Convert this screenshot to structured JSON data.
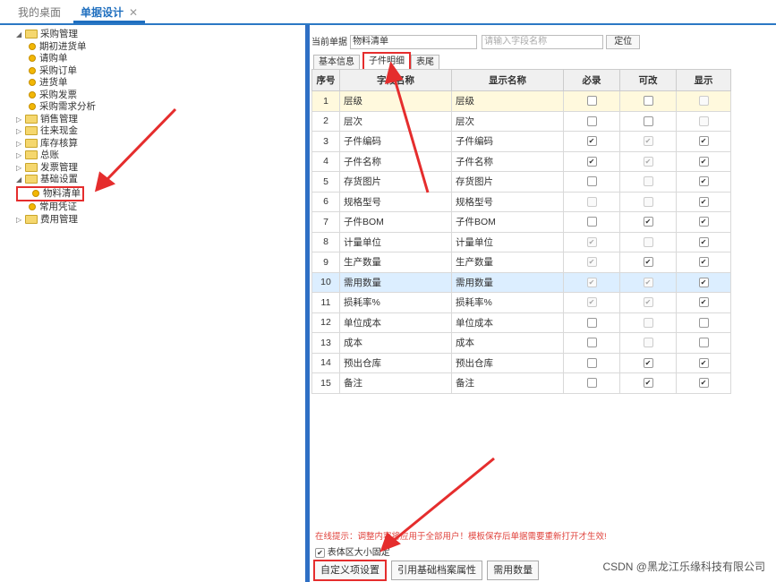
{
  "tabs": [
    {
      "label": "我的桌面"
    },
    {
      "label": "单据设计"
    }
  ],
  "tab_close": "✕",
  "tree": [
    {
      "label": "采购管理",
      "type": "folder",
      "expanded": true,
      "children": [
        "期初进货单",
        "请购单",
        "采购订单",
        "进货单",
        "采购发票",
        "采购需求分析"
      ]
    },
    {
      "label": "销售管理",
      "type": "folder",
      "expanded": false
    },
    {
      "label": "往来现金",
      "type": "folder",
      "expanded": false
    },
    {
      "label": "库存核算",
      "type": "folder",
      "expanded": false
    },
    {
      "label": "总账",
      "type": "folder",
      "expanded": false
    },
    {
      "label": "发票管理",
      "type": "folder",
      "expanded": false
    },
    {
      "label": "基础设置",
      "type": "folder",
      "expanded": true,
      "children": [
        "物料清单",
        "常用凭证"
      ]
    },
    {
      "label": "费用管理",
      "type": "folder",
      "expanded": false
    }
  ],
  "current_doc": {
    "label": "当前单据",
    "value": "物料清单"
  },
  "search": {
    "placeholder": "请输入字段名称"
  },
  "locate_button": "定位",
  "subtabs": [
    "基本信息",
    "子件明细",
    "表尾"
  ],
  "columns": [
    "序号",
    "字段名称",
    "显示名称",
    "必录",
    "可改",
    "显示"
  ],
  "rows": [
    {
      "no": "1",
      "field": "层级",
      "display": "层级",
      "req": [
        false,
        false
      ],
      "edit": [
        false,
        false
      ],
      "show": [
        false,
        true
      ]
    },
    {
      "no": "2",
      "field": "层次",
      "display": "层次",
      "req": [
        false,
        false
      ],
      "edit": [
        false,
        false
      ],
      "show": [
        false,
        true
      ]
    },
    {
      "no": "3",
      "field": "子件编码",
      "display": "子件编码",
      "req": [
        true,
        false
      ],
      "edit": [
        true,
        true
      ],
      "show": [
        true,
        false
      ]
    },
    {
      "no": "4",
      "field": "子件名称",
      "display": "子件名称",
      "req": [
        true,
        false
      ],
      "edit": [
        true,
        true
      ],
      "show": [
        true,
        false
      ]
    },
    {
      "no": "5",
      "field": "存货图片",
      "display": "存货图片",
      "req": [
        false,
        false
      ],
      "edit": [
        false,
        true
      ],
      "show": [
        true,
        false
      ]
    },
    {
      "no": "6",
      "field": "规格型号",
      "display": "规格型号",
      "req": [
        false,
        true
      ],
      "edit": [
        false,
        true
      ],
      "show": [
        true,
        false
      ]
    },
    {
      "no": "7",
      "field": "子件BOM",
      "display": "子件BOM",
      "req": [
        false,
        false
      ],
      "edit": [
        true,
        false
      ],
      "show": [
        true,
        false
      ]
    },
    {
      "no": "8",
      "field": "计量单位",
      "display": "计量单位",
      "req": [
        true,
        true
      ],
      "edit": [
        false,
        true
      ],
      "show": [
        true,
        false
      ]
    },
    {
      "no": "9",
      "field": "生产数量",
      "display": "生产数量",
      "req": [
        true,
        true
      ],
      "edit": [
        true,
        false
      ],
      "show": [
        true,
        false
      ]
    },
    {
      "no": "10",
      "field": "需用数量",
      "display": "需用数量",
      "req": [
        true,
        true
      ],
      "edit": [
        true,
        true
      ],
      "show": [
        true,
        false
      ]
    },
    {
      "no": "11",
      "field": "损耗率%",
      "display": "损耗率%",
      "req": [
        true,
        true
      ],
      "edit": [
        true,
        true
      ],
      "show": [
        true,
        false
      ]
    },
    {
      "no": "12",
      "field": "单位成本",
      "display": "单位成本",
      "req": [
        false,
        false
      ],
      "edit": [
        false,
        true
      ],
      "show": [
        false,
        false
      ]
    },
    {
      "no": "13",
      "field": "成本",
      "display": "成本",
      "req": [
        false,
        false
      ],
      "edit": [
        false,
        true
      ],
      "show": [
        false,
        false
      ]
    },
    {
      "no": "14",
      "field": "预出仓库",
      "display": "预出仓库",
      "req": [
        false,
        false
      ],
      "edit": [
        true,
        false
      ],
      "show": [
        true,
        false
      ]
    },
    {
      "no": "15",
      "field": "备注",
      "display": "备注",
      "req": [
        false,
        false
      ],
      "edit": [
        true,
        false
      ],
      "show": [
        true,
        false
      ]
    }
  ],
  "tip": "在线提示：调整内容将应用于全部用户！模板保存后单据需要重新打开才生效!",
  "fixed_label": "表体区大小固定",
  "fixed_checked": true,
  "bottom_buttons": [
    "自定义项设置",
    "引用基础档案属性",
    "需用数量"
  ],
  "watermark": "CSDN @黑龙江乐缘科技有限公司",
  "colors": {
    "accent": "#2b78c5",
    "highlight": "#e52d2d",
    "selected_row": "#dceeff"
  }
}
